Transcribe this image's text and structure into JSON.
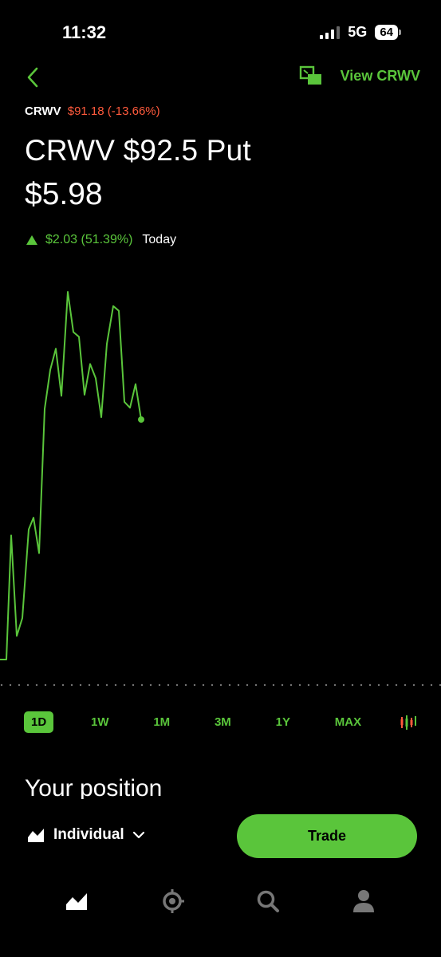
{
  "status_bar": {
    "time": "11:32",
    "network": "5G",
    "battery": "64"
  },
  "nav": {
    "view_link": "View CRWV"
  },
  "header": {
    "underlying_symbol": "CRWV",
    "underlying_price": "$91.18 (-13.66%)",
    "title": "CRWV $92.5 Put",
    "price": "$5.98",
    "change": "$2.03 (51.39%)",
    "period": "Today"
  },
  "chart_data": {
    "type": "line",
    "series": [
      {
        "values": [
          3.95,
          3.95,
          5.0,
          4.15,
          4.3,
          5.05,
          5.15,
          4.85,
          6.07,
          6.4,
          6.58,
          6.18,
          7.06,
          6.72,
          6.68,
          6.19,
          6.45,
          6.33,
          6.0,
          6.62,
          6.94,
          6.9,
          6.13,
          6.08,
          6.28,
          5.98
        ]
      }
    ],
    "color": "#5ac53b",
    "baseline_dotted": true
  },
  "ranges": [
    "1D",
    "1W",
    "1M",
    "3M",
    "1Y",
    "MAX"
  ],
  "active_range": "1D",
  "position": {
    "title": "Your position",
    "account": "Individual"
  },
  "trade_label": "Trade",
  "colors": {
    "accent": "#5ac53b",
    "negative": "#ff5a3c",
    "background": "#000000"
  },
  "tabs": [
    "investing-icon",
    "crypto-icon",
    "search-icon",
    "account-icon"
  ]
}
